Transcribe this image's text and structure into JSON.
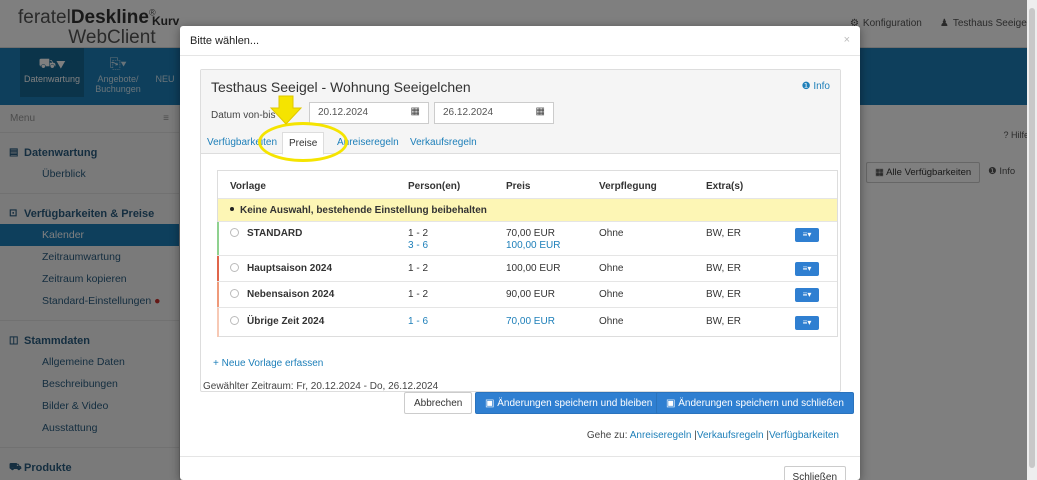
{
  "app": {
    "brand_light": "feratel",
    "brand_bold": "Deskline",
    "brand_reg": "®",
    "brand_sub": "WebClient",
    "kurv_text": "Kurv",
    "top_right": {
      "config": "Konfiguration",
      "user": "Testhaus Seeigel"
    },
    "nav": [
      {
        "label": "Datenwartung"
      },
      {
        "label": "Angebote/ Buchungen"
      },
      {
        "label": "NEU"
      }
    ],
    "menu_label": "Menu",
    "sidebar": {
      "sections": [
        {
          "title": "Datenwartung",
          "items": [
            "Überblick"
          ]
        },
        {
          "title": "Verfügbarkeiten & Preise",
          "items": [
            "Kalender",
            "Zeitraumwartung",
            "Zeitraum kopieren",
            "Standard-Einstellungen"
          ]
        },
        {
          "title": "Stammdaten",
          "items": [
            "Allgemeine Daten",
            "Beschreibungen",
            "Bilder & Video",
            "Ausstattung"
          ]
        },
        {
          "title": "Produkte",
          "items": []
        }
      ]
    },
    "hilfe": "? Hilfe",
    "bg_buttons": {
      "all_avail": "Alle Verfügbarkeiten",
      "info": "Info"
    }
  },
  "modal": {
    "title": "Bitte wählen...",
    "close": "×",
    "property": "Testhaus Seeigel - Wohnung Seeigelchen",
    "info": "Info",
    "date_label": "Datum von-bis",
    "date_from": "20.12.2024",
    "date_to": "26.12.2024",
    "tabs": [
      "Verfügbarkeiten",
      "Preise",
      "Anreiseregeln",
      "Verkaufsregeln"
    ],
    "table": {
      "headers": [
        "Vorlage",
        "Person(en)",
        "Preis",
        "Verpflegung",
        "Extra(s)"
      ],
      "keep_row": "Keine Auswahl, bestehende Einstellung beibehalten",
      "rows": [
        {
          "name": "STANDARD",
          "persons": [
            "1 - 2",
            "3 - 6"
          ],
          "prices": [
            "70,00 EUR",
            "100,00 EUR"
          ],
          "board": "Ohne",
          "extras": "BW, ER"
        },
        {
          "name": "Hauptsaison 2024",
          "persons": [
            "1 - 2"
          ],
          "prices": [
            "100,00 EUR"
          ],
          "board": "Ohne",
          "extras": "BW, ER"
        },
        {
          "name": "Nebensaison 2024",
          "persons": [
            "1 - 2"
          ],
          "prices": [
            "90,00 EUR"
          ],
          "board": "Ohne",
          "extras": "BW, ER"
        },
        {
          "name": "Übrige Zeit 2024",
          "persons": [
            "1 - 6"
          ],
          "prices": [
            "70,00 EUR"
          ],
          "board": "Ohne",
          "extras": "BW, ER"
        }
      ]
    },
    "new_template": "+ Neue Vorlage erfassen",
    "selected_period": "Gewählter Zeitraum: Fr, 20.12.2024 - Do, 26.12.2024",
    "cancel": "Abbrechen",
    "save_stay": "Änderungen speichern und bleiben",
    "save_close": "Änderungen speichern und schließen",
    "goto_prefix": "Gehe zu:",
    "goto_links": [
      "Anreiseregeln",
      "Verkaufsregeln",
      "Verfügbarkeiten"
    ],
    "close_button": "Schließen"
  },
  "colors": {
    "primary": "#1d7fb9",
    "button": "#2f7fd1",
    "highlight": "#fdf6b5",
    "annotation": "#f5e400"
  }
}
